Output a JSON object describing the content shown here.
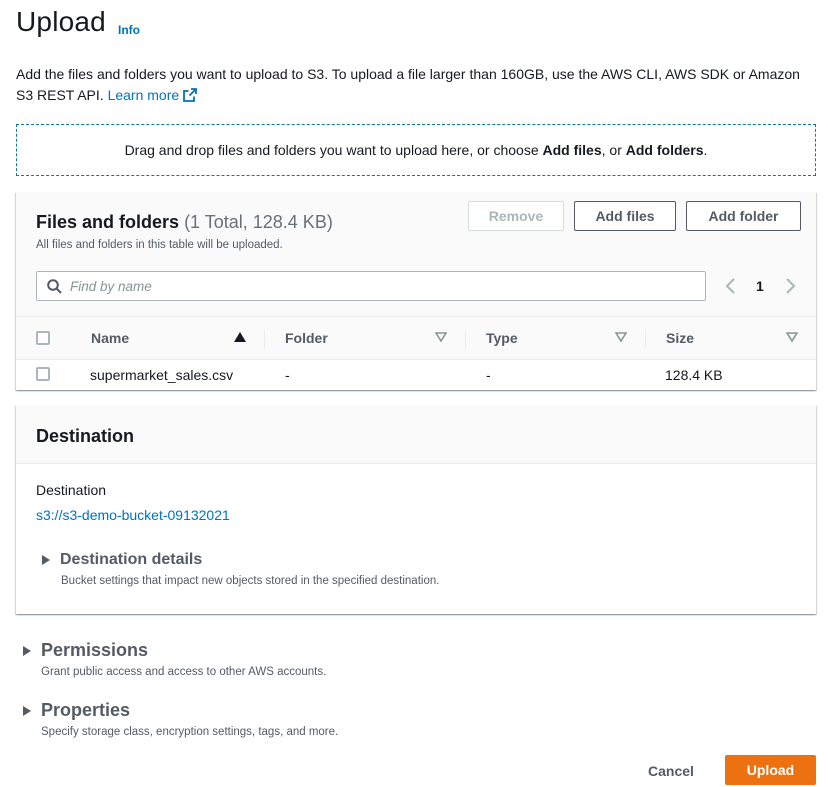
{
  "header": {
    "title": "Upload",
    "info_link": "Info"
  },
  "description": {
    "text": "Add the files and folders you want to upload to S3. To upload a file larger than 160GB, use the AWS CLI, AWS SDK or Amazon S3 REST API.",
    "learn_more": "Learn more"
  },
  "dropzone": {
    "prefix": "Drag and drop files and folders you want to upload here, or choose ",
    "add_files": "Add files",
    "middle": ", or ",
    "add_folders": "Add folders",
    "suffix": "."
  },
  "files_panel": {
    "title": "Files and folders",
    "counter": "(1 Total, 128.4 KB)",
    "subtitle": "All files and folders in this table will be uploaded.",
    "remove_label": "Remove",
    "add_files_label": "Add files",
    "add_folder_label": "Add folder",
    "search_placeholder": "Find by name",
    "current_page": "1",
    "columns": [
      "Name",
      "Folder",
      "Type",
      "Size"
    ],
    "rows": [
      {
        "name": "supermarket_sales.csv",
        "folder": "-",
        "type": "-",
        "size": "128.4 KB"
      }
    ]
  },
  "destination_panel": {
    "title": "Destination",
    "label": "Destination",
    "value": "s3://s3-demo-bucket-09132021",
    "details_title": "Destination details",
    "details_desc": "Bucket settings that impact new objects stored in the specified destination."
  },
  "permissions": {
    "title": "Permissions",
    "desc": "Grant public access and access to other AWS accounts."
  },
  "properties": {
    "title": "Properties",
    "desc": "Specify storage class, encryption settings, tags, and more."
  },
  "footer": {
    "cancel_label": "Cancel",
    "upload_label": "Upload"
  },
  "colors": {
    "link": "#0073bb",
    "primary_button": "#ec7211",
    "dropzone_border": "#0a7f8a"
  },
  "icons": [
    "external-link-icon",
    "search-icon",
    "chevron-left-icon",
    "chevron-right-icon",
    "sort-ascending-icon",
    "sort-filter-icon",
    "caret-right-icon"
  ]
}
